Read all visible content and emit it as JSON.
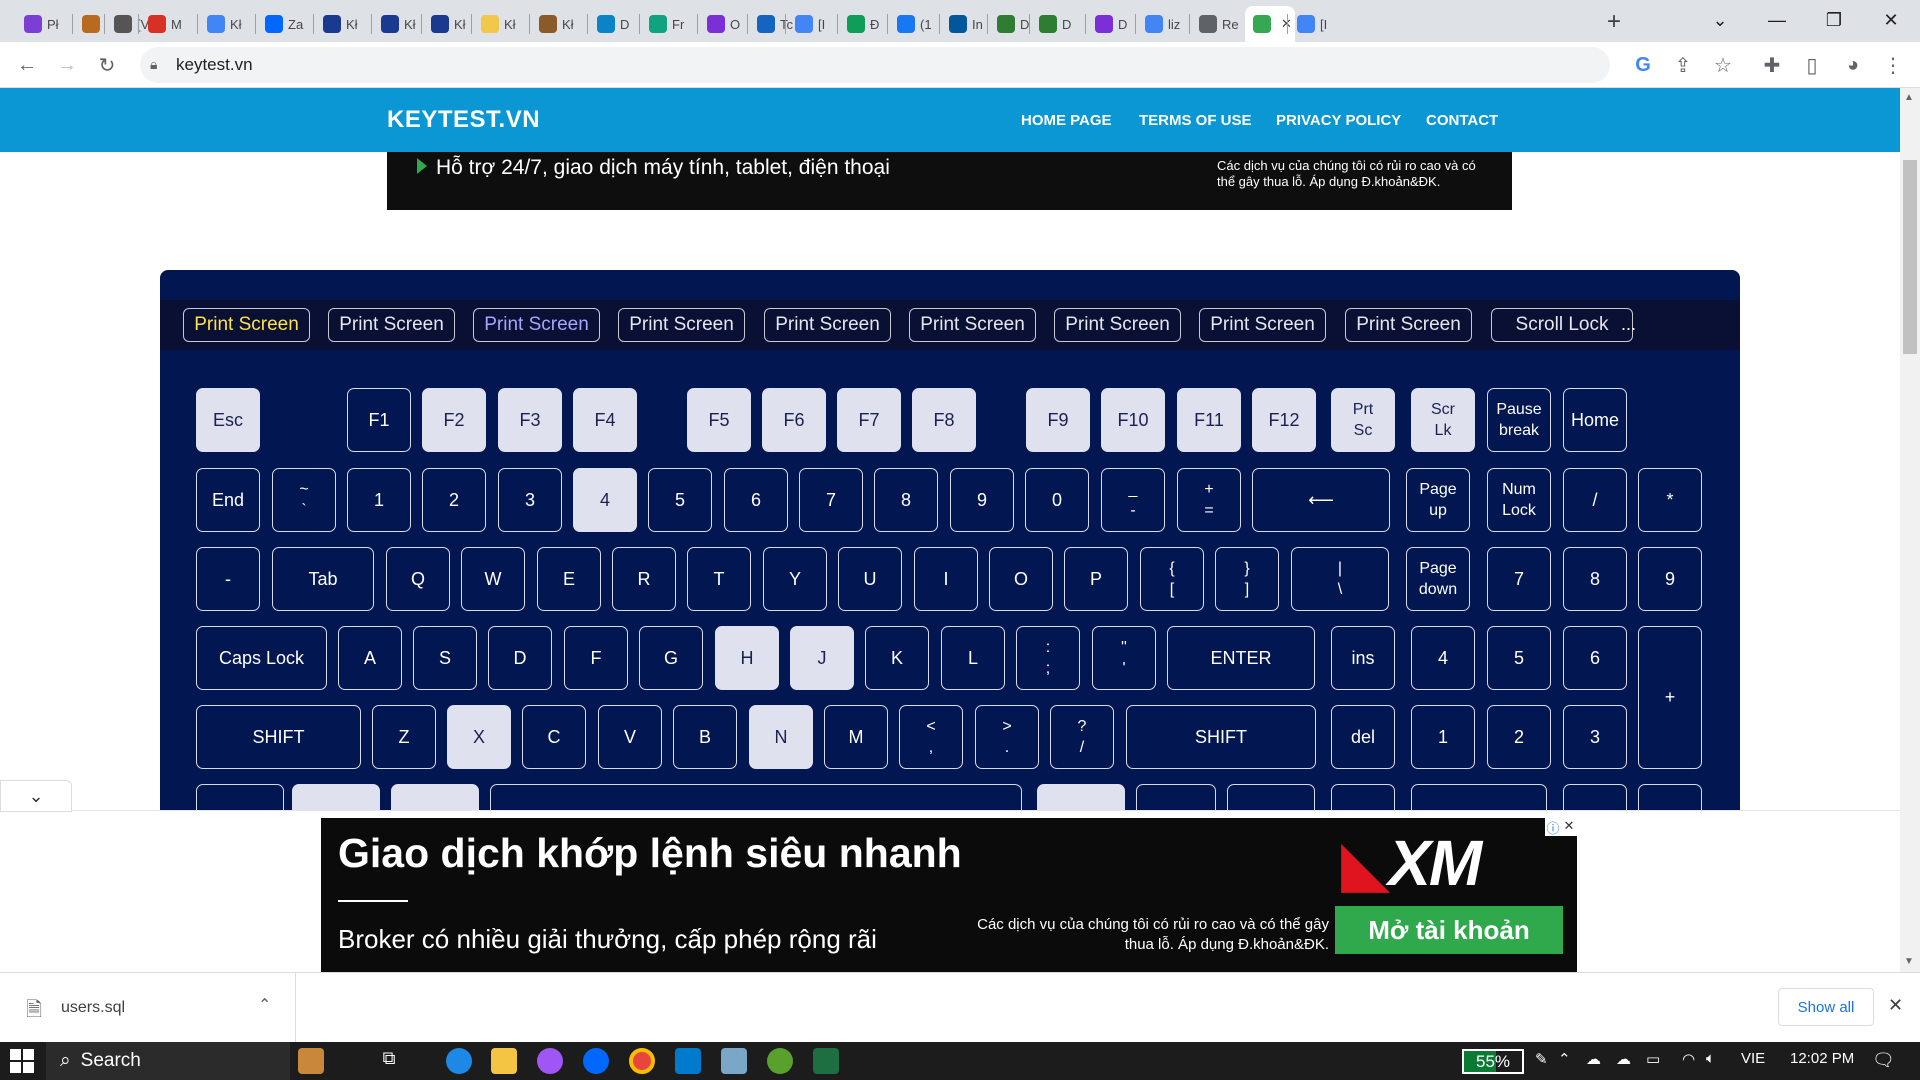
{
  "browser": {
    "tabs": [
      {
        "label": "Pł",
        "icon": "play-icon",
        "color": "#7b3fd6"
      },
      {
        "label": "",
        "icon": "bear-icon",
        "color": "#b86b1e"
      },
      {
        "label": "[V",
        "icon": "page-icon",
        "color": "#555555"
      },
      {
        "label": "M",
        "icon": "m-logo-icon",
        "color": "#d93025"
      },
      {
        "label": "Kł",
        "icon": "google-icon",
        "color": "#4285f4"
      },
      {
        "label": "Za",
        "icon": "zalo-icon",
        "color": "#0068ff"
      },
      {
        "label": "Kł",
        "icon": "nda-icon",
        "color": "#1a3a8f"
      },
      {
        "label": "Kł",
        "icon": "nda-icon",
        "color": "#1a3a8f"
      },
      {
        "label": "Kł",
        "icon": "nda-icon",
        "color": "#1a3a8f"
      },
      {
        "label": "Kł",
        "icon": "coin-icon",
        "color": "#f2c84b"
      },
      {
        "label": "Kł",
        "icon": "page-icon",
        "color": "#8a5a2b"
      },
      {
        "label": "D",
        "icon": "feather-icon",
        "color": "#0a84c6"
      },
      {
        "label": "Fr",
        "icon": "openai-icon",
        "color": "#10a37f"
      },
      {
        "label": "O",
        "icon": "u-icon",
        "color": "#7b2fd6"
      },
      {
        "label": "Tc",
        "icon": "v-icon",
        "color": "#1565c0"
      },
      {
        "label": "[I",
        "icon": "docs-icon",
        "color": "#4285f4"
      },
      {
        "label": "Đ",
        "icon": "sheets-icon",
        "color": "#0f9d58"
      },
      {
        "label": "(1",
        "icon": "facebook-icon",
        "color": "#1877f2"
      },
      {
        "label": "In",
        "icon": "flutter-icon",
        "color": "#02569b"
      },
      {
        "label": "D",
        "icon": "200-icon",
        "color": "#2e7d32"
      },
      {
        "label": "D",
        "icon": "200-icon",
        "color": "#2e7d32"
      },
      {
        "label": "D",
        "icon": "u-icon",
        "color": "#7b2fd6"
      },
      {
        "label": "liz",
        "icon": "google-icon",
        "color": "#4285f4"
      },
      {
        "label": "Re",
        "icon": "globe-icon",
        "color": "#5f6368"
      },
      {
        "label": "",
        "icon": "keytest-icon",
        "color": "#34a853",
        "active": true
      },
      {
        "label": "[I",
        "icon": "docs-icon",
        "color": "#4285f4"
      }
    ],
    "url": "keytest.vn"
  },
  "site": {
    "logo": "KEYTEST.VN",
    "nav": [
      "HOME PAGE",
      "TERMS OF USE",
      "PRIVACY POLICY",
      "CONTACT"
    ],
    "top_banner_text": "Hỗ trợ 24/7, giao dịch máy tính, tablet, điện thoại",
    "top_banner_small": "Các dịch vụ của chúng tôi có rủi ro cao và có thể gây thua lỗ. Áp dụng Đ.khoản&ĐK."
  },
  "key_history": [
    "Print Screen",
    "Print Screen",
    "Print Screen",
    "Print Screen",
    "Print Screen",
    "Print Screen",
    "Print Screen",
    "Print Screen",
    "Print Screen",
    "Scroll Lock"
  ],
  "key_history_more": "...",
  "key_history_colors": [
    "#ffe24a",
    "#e6e6f0",
    "#a9a4ff",
    "#e6e6f0",
    "#e6e6f0",
    "#e6e6f0",
    "#e6e6f0",
    "#e6e6f0",
    "#e6e6f0",
    "#e6e6f0"
  ],
  "keyboard": {
    "row0": [
      "Esc",
      "F1",
      "F2",
      "F3",
      "F4",
      "F5",
      "F6",
      "F7",
      "F8",
      "F9",
      "F10",
      "F11",
      "F12",
      "Prt\nSc",
      "Scr\nLk",
      "Pause\nbreak",
      "Home"
    ],
    "row1": [
      "End",
      "~\n`",
      "1",
      "2",
      "3",
      "4",
      "5",
      "6",
      "7",
      "8",
      "9",
      "0",
      "_\n-",
      "+\n=",
      "⟵",
      "Page\nup",
      "Num\nLock",
      "/",
      "*"
    ],
    "row2": [
      "-",
      "Tab",
      "Q",
      "W",
      "E",
      "R",
      "T",
      "Y",
      "U",
      "I",
      "O",
      "P",
      "{\n[",
      "}\n]",
      "|\n\\",
      "Page\ndown",
      "7",
      "8",
      "9"
    ],
    "row3": [
      "Caps Lock",
      "A",
      "S",
      "D",
      "F",
      "G",
      "H",
      "J",
      "K",
      "L",
      ":\n;",
      "\"\n'",
      "ENTER",
      "ins",
      "4",
      "5",
      "6",
      "+"
    ],
    "row4": [
      "SHIFT",
      "Z",
      "X",
      "C",
      "V",
      "B",
      "N",
      "M",
      "<\n,",
      ">\n.",
      "?\n/",
      "SHIFT",
      "del",
      "1",
      "2",
      "3"
    ]
  },
  "ad": {
    "headline": "Giao dịch khớp lệnh siêu nhanh",
    "subline": "Broker có nhiều giải thưởng, cấp phép rộng rãi",
    "disclaimer": "Các dịch vụ của chúng tôi có rủi ro cao và có thể gây thua lỗ. Áp dụng Đ.khoản&ĐK.",
    "cta": "Mở tài khoản",
    "brand": "XM"
  },
  "downloads": {
    "file": "users.sql",
    "show_all": "Show all"
  },
  "taskbar": {
    "search": "Search",
    "battery": "55%",
    "battery_level": 0.55,
    "lang": "VIE",
    "time": "12:02 PM"
  }
}
